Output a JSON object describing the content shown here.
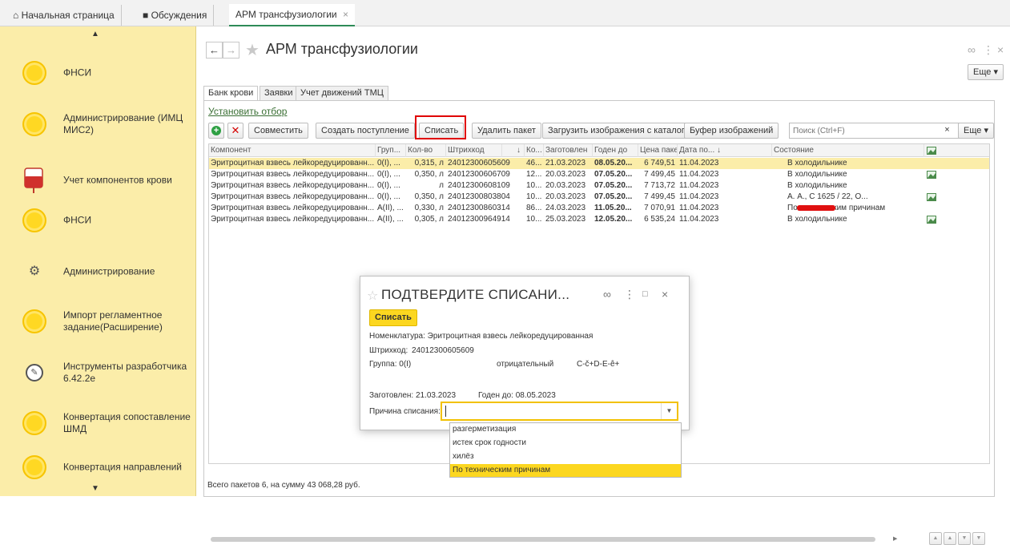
{
  "top_tabs": [
    {
      "label": "Начальная страница"
    },
    {
      "label": "Обсуждения"
    },
    {
      "label": "АРМ трансфузиологии"
    }
  ],
  "sidebar": {
    "items": [
      {
        "label": "ФНСИ",
        "icon": "yellow-circle-icon"
      },
      {
        "label": "Администрирование (ИМЦ МИС2)",
        "icon": "yellow-circle-icon"
      },
      {
        "label": "Учет компонентов крови",
        "icon": "blood-bag-icon"
      },
      {
        "label": "ФНСИ",
        "icon": "yellow-circle-icon"
      },
      {
        "label": "Администрирование",
        "icon": "gear-icon"
      },
      {
        "label": "Импорт регламентное задание(Расширение)",
        "icon": "yellow-circle-icon"
      },
      {
        "label": "Инструменты разработчика 6.42.2e",
        "icon": "tools-icon"
      },
      {
        "label": "Конвертация сопоставление ШМД",
        "icon": "yellow-circle-icon"
      },
      {
        "label": "Конвертация направлений",
        "icon": "yellow-circle-icon"
      }
    ]
  },
  "header": {
    "title": "АРМ трансфузиологии",
    "more_label": "Еще ▾"
  },
  "form_tabs": [
    {
      "label": "Банк крови"
    },
    {
      "label": "Заявки"
    },
    {
      "label": "Учет движений ТМЦ"
    }
  ],
  "toolbar": {
    "set_filter": "Установить отбор",
    "combine": "Совместить",
    "create_receipt": "Создать поступление",
    "write_off": "Списать",
    "delete_package": "Удалить пакет",
    "load_images": "Загрузить изображения с каталога",
    "image_buffer": "Буфер изображений",
    "search_placeholder": "Поиск (Ctrl+F)",
    "clear": "×",
    "more": "Еще ▾"
  },
  "table": {
    "columns": [
      "Компонент",
      "Груп...",
      "Кол-во",
      "Штрихкод",
      "↓",
      "Ко...",
      "Заготовлен",
      "Годен до",
      "Цена паке...",
      "Дата по... ↓",
      "Состояние"
    ],
    "rows": [
      {
        "component": "Эритроцитная взвесь лейкоредуцированн...",
        "group": "0(I), ...",
        "qty": "0,315, л",
        "barcode": "24012300605609",
        "ko": "46...",
        "prepared": "21.03.2023",
        "expires": "08.05.20...",
        "price": "6 749,51",
        "date": "11.04.2023",
        "state": "В холодильнике",
        "pic": false
      },
      {
        "component": "Эритроцитная взвесь лейкоредуцированн...",
        "group": "0(I), ...",
        "qty": "0,350, л",
        "barcode": "24012300606709",
        "ko": "12...",
        "prepared": "20.03.2023",
        "expires": "07.05.20...",
        "price": "7 499,45",
        "date": "11.04.2023",
        "state": "В холодильнике",
        "pic": true
      },
      {
        "component": "Эритроцитная взвесь лейкоредуцированн...",
        "group": "0(I), ...",
        "qty": "л",
        "barcode": "24012300608109",
        "ko": "10...",
        "prepared": "20.03.2023",
        "expires": "07.05.20...",
        "price": "7 713,72",
        "date": "11.04.2023",
        "state": "В холодильнике",
        "pic": false
      },
      {
        "component": "Эритроцитная взвесь лейкоредуцированн...",
        "group": "0(I), ...",
        "qty": "0,350, л",
        "barcode": "24012300803804",
        "ko": "10...",
        "prepared": "20.03.2023",
        "expires": "07.05.20...",
        "price": "7 499,45",
        "date": "11.04.2023",
        "state": "А. А., С 1625 / 22, О...",
        "pic": true
      },
      {
        "component": "Эритроцитная взвесь лейкоредуцированн...",
        "group": "A(II), ...",
        "qty": "0,330, л",
        "barcode": "24012300860314",
        "ko": "86...",
        "prepared": "24.03.2023",
        "expires": "11.05.20...",
        "price": "7 070,91",
        "date": "11.04.2023",
        "state": "По техническим причинам",
        "pic": false
      },
      {
        "component": "Эритроцитная взвесь лейкоредуцированн...",
        "group": "A(II), ...",
        "qty": "0,305, л",
        "barcode": "24012300964914",
        "ko": "10...",
        "prepared": "25.03.2023",
        "expires": "12.05.20...",
        "price": "6 535,24",
        "date": "11.04.2023",
        "state": "В холодильнике",
        "pic": true
      }
    ]
  },
  "footer": {
    "total": "Всего пакетов 6, на сумму 43 068,28 руб."
  },
  "dialog": {
    "title": "ПОДТВЕРДИТЕ СПИСАНИ...",
    "confirm_button": "Списать",
    "nomenclature": "Номенклатура: Эритроцитная взвесь лейкоредуцированная",
    "barcode_label": "Штрихкод:",
    "barcode_value": "24012300605609",
    "group": "Группа: 0(I)",
    "rh": "отрицательный",
    "phenotype": "C-č+D-E-ê+",
    "prepared": "Заготовлен: 21.03.2023",
    "expires": "Годен до: 08.05.2023",
    "reason_label": "Причина списания:",
    "reason_value": ""
  },
  "reason_options": [
    {
      "label": "разгерметизация"
    },
    {
      "label": "истек срок годности"
    },
    {
      "label": "хилёз"
    },
    {
      "label": "По техническим причинам"
    }
  ],
  "colors": {
    "sidebar_bg": "#fbeda9",
    "accent_yellow": "#fcd720",
    "selected_row": "#fbeda9",
    "highlight_red": "#e00000",
    "link_green": "#3a6f34"
  }
}
